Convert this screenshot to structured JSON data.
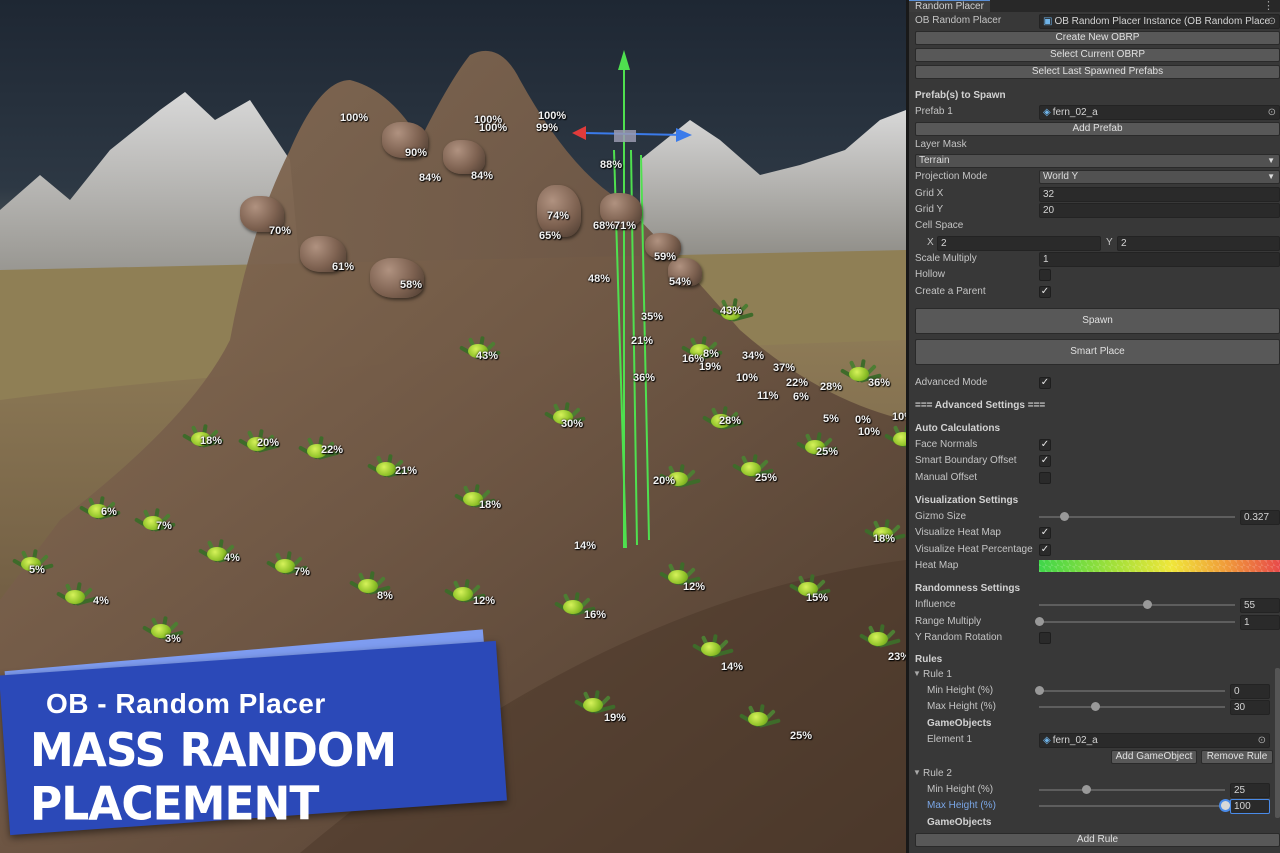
{
  "scene": {
    "labels_rocks": [
      "100%",
      "100%",
      "100%",
      "100%",
      "99%",
      "90%",
      "84%",
      "84%",
      "88%",
      "74%",
      "70%",
      "65%",
      "68%",
      "71%",
      "61%",
      "58%",
      "59%",
      "54%"
    ],
    "labels_ferns": [
      "48%",
      "43%",
      "35%",
      "21%",
      "43%",
      "16%",
      "8%",
      "19%",
      "34%",
      "37%",
      "36%",
      "10%",
      "22%",
      "28%",
      "36%",
      "11%",
      "6%",
      "5%",
      "0%",
      "10%",
      "10%",
      "30%",
      "28%",
      "18%",
      "20%",
      "22%",
      "21%",
      "25%",
      "25%",
      "20%",
      "18%",
      "14%",
      "6%",
      "7%",
      "4%",
      "7%",
      "5%",
      "4%",
      "8%",
      "12%",
      "12%",
      "16%",
      "15%",
      "18%",
      "3%",
      "14%",
      "19%",
      "25%",
      "23%"
    ]
  },
  "banner": {
    "subtitle": "OB - Random Placer",
    "title": "MASS RANDOM PLACEMENT"
  },
  "inspector": {
    "tab": "Random Placer",
    "ob_label": "OB Random Placer",
    "ob_value": "OB Random Placer Instance (OB Random Place",
    "create_btn": "Create New OBRP",
    "select_btn": "Select Current OBRP",
    "select_last_btn": "Select Last Spawned Prefabs",
    "prefabs_header": "Prefab(s) to Spawn",
    "prefab1_label": "Prefab 1",
    "prefab1_value": "fern_02_a",
    "add_prefab_btn": "Add Prefab",
    "layer_mask_label": "Layer Mask",
    "layer_mask_value": "Terrain",
    "projection_label": "Projection Mode",
    "projection_value": "World Y",
    "gridx_label": "Grid X",
    "gridx_value": "32",
    "gridy_label": "Grid Y",
    "gridy_value": "20",
    "cellspace_label": "Cell Space",
    "cell_x_label": "X",
    "cell_x_value": "2",
    "cell_y_label": "Y",
    "cell_y_value": "2",
    "scale_label": "Scale Multiply",
    "scale_value": "1",
    "hollow_label": "Hollow",
    "hollow_checked": false,
    "parent_label": "Create a Parent",
    "parent_checked": true,
    "spawn_btn": "Spawn",
    "smart_btn": "Smart Place",
    "advanced_label": "Advanced Mode",
    "advanced_checked": true,
    "adv_header": "=== Advanced Settings ===",
    "auto_header": "Auto Calculations",
    "face_normals_label": "Face Normals",
    "face_normals_checked": true,
    "smart_boundary_label": "Smart Boundary Offset",
    "smart_boundary_checked": true,
    "manual_offset_label": "Manual Offset",
    "manual_offset_checked": false,
    "vis_header": "Visualization Settings",
    "gizmo_label": "Gizmo Size",
    "gizmo_value": "0.327",
    "gizmo_fraction": 0.13,
    "heatmap_vis_label": "Visualize Heat Map",
    "heatmap_vis_checked": true,
    "heatpct_label": "Visualize Heat Percentage",
    "heatpct_checked": true,
    "heatmap_label": "Heat Map",
    "rand_header": "Randomness Settings",
    "influence_label": "Influence",
    "influence_value": "55",
    "influence_fraction": 0.55,
    "range_label": "Range Multiply",
    "range_value": "1",
    "range_fraction": 0.0,
    "yrot_label": "Y Random Rotation",
    "yrot_checked": false,
    "rules_header": "Rules",
    "rule1_label": "Rule 1",
    "rule1_min_label": "Min Height (%)",
    "rule1_min_value": "0",
    "rule1_min_fraction": 0.0,
    "rule1_max_label": "Max Height (%)",
    "rule1_max_value": "30",
    "rule1_max_fraction": 0.3,
    "go_header": "GameObjects",
    "element1_label": "Element 1",
    "element1_value": "fern_02_a",
    "add_go_btn": "Add GameObject",
    "remove_rule_btn": "Remove Rule",
    "rule2_label": "Rule 2",
    "rule2_min_label": "Min Height (%)",
    "rule2_min_value": "25",
    "rule2_min_fraction": 0.25,
    "rule2_max_label": "Max Height (%)",
    "rule2_max_value": "100",
    "rule2_max_fraction": 1.0,
    "go_header2": "GameObjects",
    "add_rule_btn": "Add Rule",
    "checkmark": "✓"
  }
}
